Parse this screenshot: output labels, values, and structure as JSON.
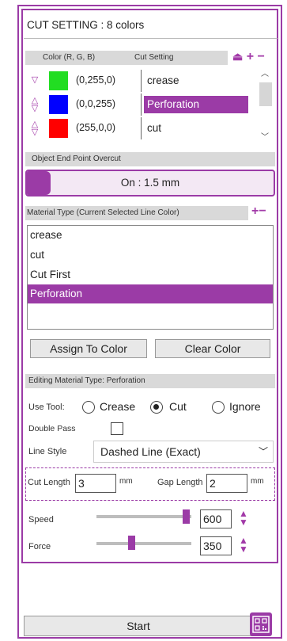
{
  "title": "CUT SETTING : 8 colors",
  "color_section": {
    "col_color": "Color (R, G, B)",
    "col_setting": "Cut Setting",
    "rows": [
      {
        "rgb": "(0,255,0)",
        "setting": "crease",
        "color": "#22dd22",
        "selected": false
      },
      {
        "rgb": "(0,0,255)",
        "setting": "Perforation",
        "color": "#0000ff",
        "selected": true
      },
      {
        "rgb": "(255,0,0)",
        "setting": "cut",
        "color": "#ff0000",
        "selected": false
      }
    ]
  },
  "overcut": {
    "header": "Object End Point Overcut",
    "value": "On : 1.5 mm"
  },
  "material": {
    "header": "Material Type (Current Selected Line Color)",
    "items": [
      "crease",
      "cut",
      "Cut First",
      "Perforation"
    ],
    "selected_index": 3,
    "assign_label": "Assign To Color",
    "clear_label": "Clear Color"
  },
  "editing": {
    "header": "Editing Material Type: Perforation",
    "use_tool_label": "Use Tool:",
    "tools": [
      "Crease",
      "Cut",
      "Ignore"
    ],
    "selected_tool": "Cut",
    "double_pass_label": "Double Pass",
    "line_style_label": "Line Style",
    "line_style_value": "Dashed Line (Exact)",
    "cut_length_label": "Cut Length",
    "cut_length_value": "3",
    "gap_length_label": "Gap Length",
    "gap_length_value": "2",
    "unit": "mm",
    "speed_label": "Speed",
    "speed_value": "600",
    "force_label": "Force",
    "force_value": "350"
  },
  "start_label": "Start",
  "accent": "#9b3ba6"
}
